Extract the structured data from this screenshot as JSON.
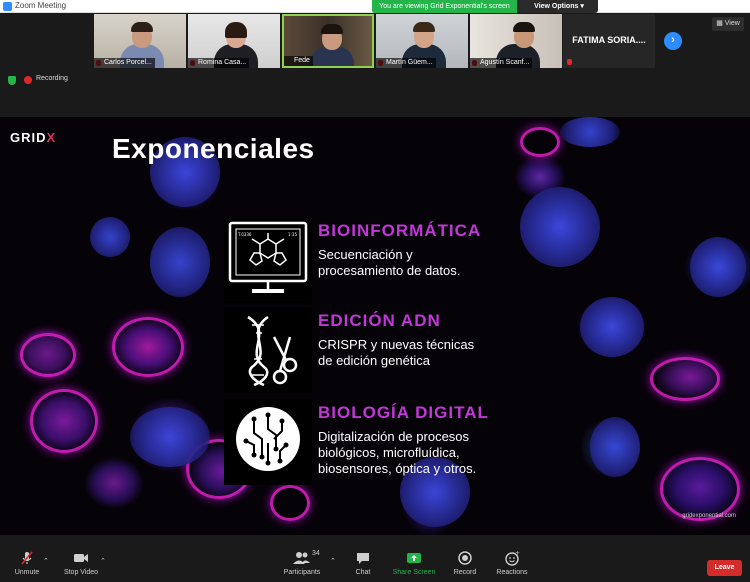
{
  "window": {
    "title": "Zoom Meeting"
  },
  "share_banner": {
    "message": "You are viewing Grid Exponential's screen",
    "options_label": "View Options"
  },
  "participants": [
    {
      "name": "Carlos Porcel..."
    },
    {
      "name": "Romina Casa..."
    },
    {
      "name": "Fede"
    },
    {
      "name": "Martín Güem..."
    },
    {
      "name": "Agustín Scanf..."
    }
  ],
  "name_tile": {
    "name": "FATIMA SORIA...."
  },
  "view_button": "View",
  "recording": {
    "label": "Recording"
  },
  "slide": {
    "logo_text": "GRID",
    "logo_accent": "X",
    "title": "Exponenciales",
    "sections": [
      {
        "heading": "BIOINFORMÁTICA",
        "line1": "Secuenciación y",
        "line2": "procesamiento de datos.",
        "line3": ""
      },
      {
        "heading": "EDICIÓN ADN",
        "line1": "CRISPR y nuevas técnicas",
        "line2": "de edición genética",
        "line3": ""
      },
      {
        "heading": "BIOLOGÍA DIGITAL",
        "line1": "Digitalización de procesos",
        "line2": "biológicos, microfluídica,",
        "line3": "biosensores, óptica y otros."
      }
    ],
    "monitor_text": {
      "left": "T.0336",
      "right": "1:35"
    },
    "website": "gridexponential.com",
    "accent_color": "#c237d8"
  },
  "toolbar": {
    "unmute": "Unmute",
    "stop_video": "Stop Video",
    "participants": "Participants",
    "participants_count": "34",
    "chat": "Chat",
    "share_screen": "Share Screen",
    "record": "Record",
    "reactions": "Reactions",
    "leave": "Leave"
  },
  "colors": {
    "zoom_blue": "#2d8cff",
    "share_green": "#23b54a",
    "leave_red": "#d42b2b"
  }
}
